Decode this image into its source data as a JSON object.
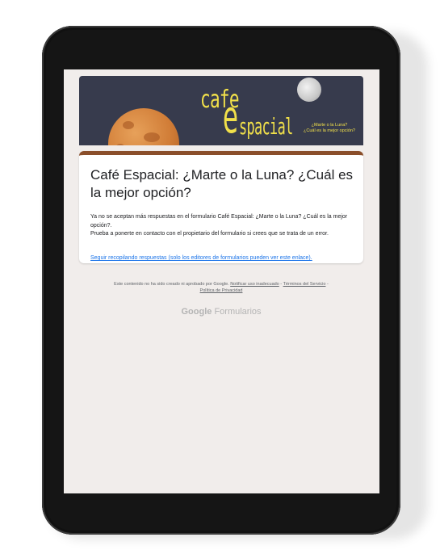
{
  "banner": {
    "logo_cafe": "cafe",
    "logo_e": "e",
    "logo_espacial": "spacial",
    "tagline_line1": "¿Marte o la Luna?",
    "tagline_line2": "¿Cuál es la mejor opción?"
  },
  "form": {
    "title": "Café Espacial: ¿Marte o la Luna? ¿Cuál es la mejor opción?",
    "closed_message_1": "Ya no se aceptan más respuestas en el formulario Café Espacial: ¿Marte o la Luna? ¿Cuál es la mejor opción?.",
    "closed_message_2": "Prueba a ponerte en contacto con el propietario del formulario si crees que se trata de un error.",
    "keep_collecting_link": "Seguir recopilando respuestas (solo los editores de formularios pueden ver este enlace)."
  },
  "footer": {
    "disclaimer": "Este contenido no ha sido creado ni aprobado por Google.",
    "report_abuse": "Notificar uso inadecuado",
    "separator": "-",
    "terms": "Términos del Servicio",
    "privacy": "Política de Privacidad"
  },
  "branding": {
    "google": "Google",
    "formularios": "Formularios"
  },
  "colors": {
    "banner_bg": "#373b4d",
    "logo_yellow": "#f1e04a",
    "card_accent": "#8a4e2a",
    "link_blue": "#1a73e8",
    "page_bg": "#f1edeb"
  }
}
